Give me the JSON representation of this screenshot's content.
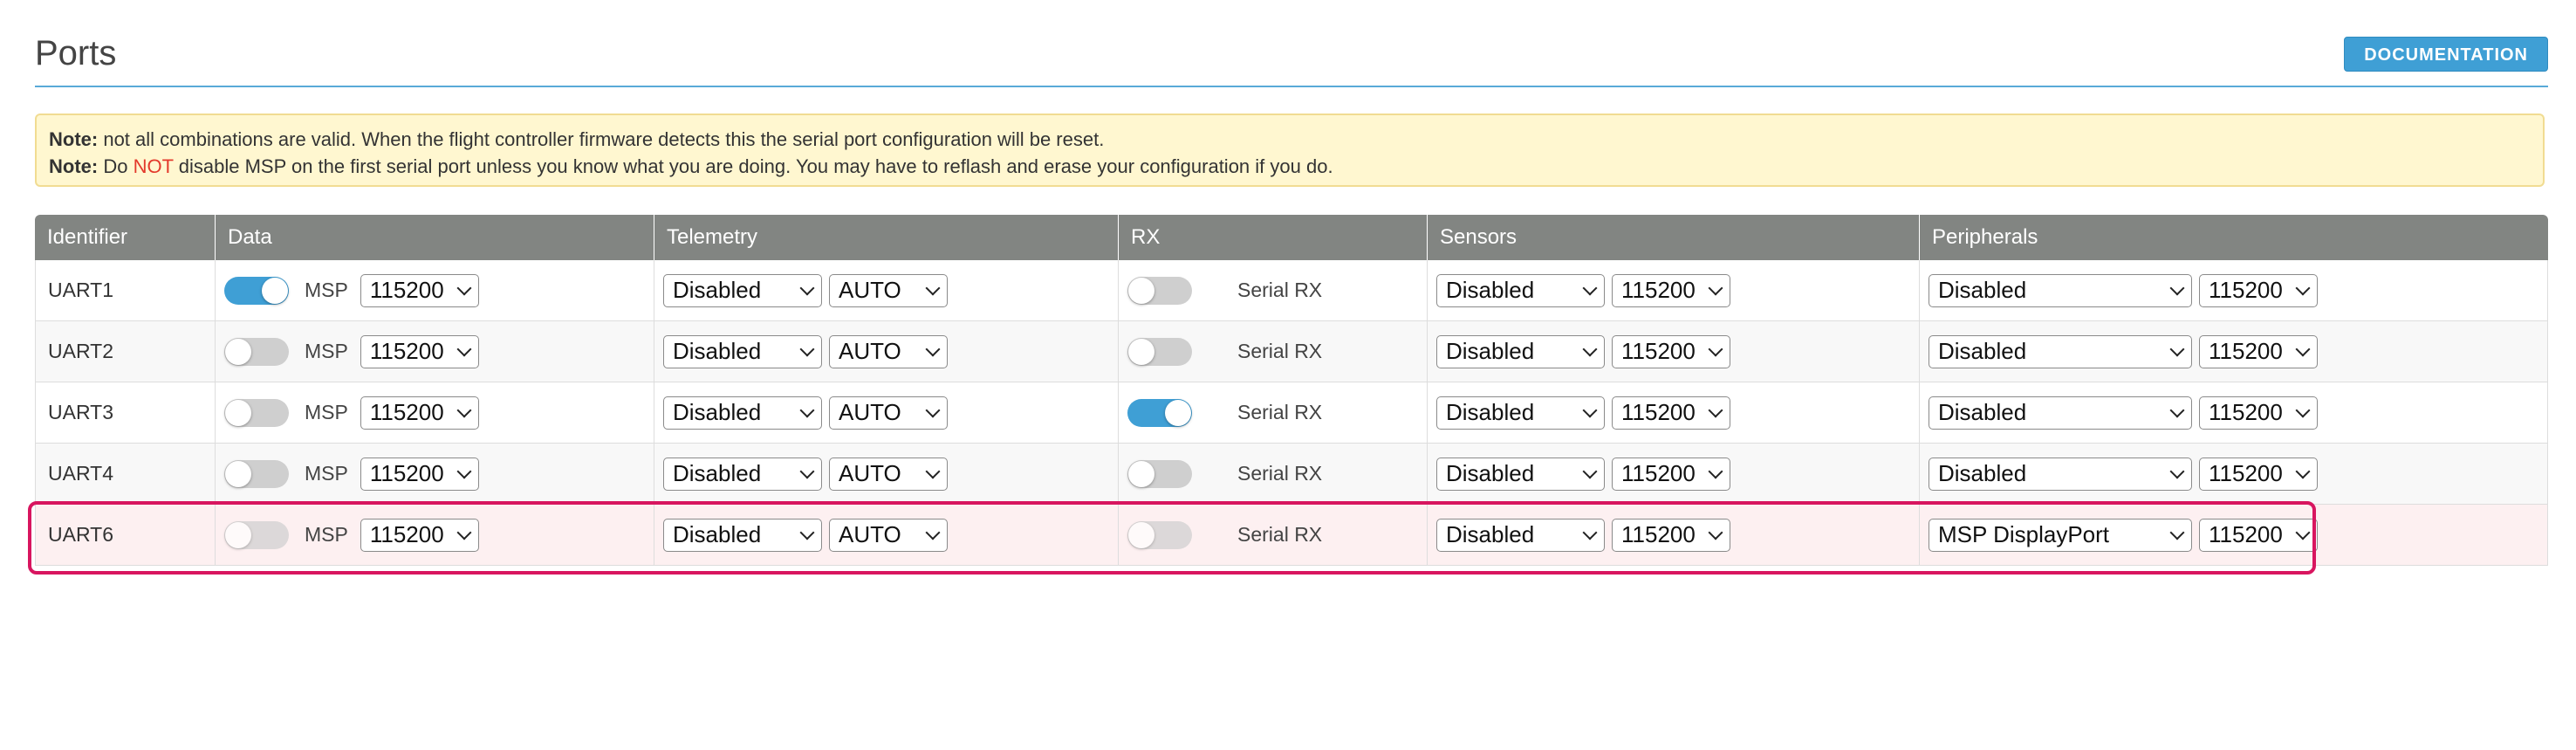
{
  "page": {
    "title": "Ports",
    "doc_button": "DOCUMENTATION"
  },
  "notes": {
    "line1_label": "Note:",
    "line1_text": " not all combinations are valid. When the flight controller firmware detects this the serial port configuration will be reset.",
    "line2_label": "Note:",
    "line2_pre": " Do ",
    "line2_not": "NOT",
    "line2_post": " disable MSP on the first serial port unless you know what you are doing. You may have to reflash and erase your configuration if you do."
  },
  "table": {
    "headers": [
      "Identifier",
      "Data",
      "Telemetry",
      "RX",
      "Sensors",
      "Peripherals"
    ],
    "msp_label": "MSP",
    "rx_label": "Serial RX",
    "rows": [
      {
        "id": "UART1",
        "msp_on": true,
        "data_baud": "115200",
        "telemetry": "Disabled",
        "telemetry_baud": "AUTO",
        "rx_on": false,
        "sensors": "Disabled",
        "sensors_baud": "115200",
        "peripherals": "Disabled",
        "peripherals_baud": "115200"
      },
      {
        "id": "UART2",
        "msp_on": false,
        "data_baud": "115200",
        "telemetry": "Disabled",
        "telemetry_baud": "AUTO",
        "rx_on": false,
        "sensors": "Disabled",
        "sensors_baud": "115200",
        "peripherals": "Disabled",
        "peripherals_baud": "115200"
      },
      {
        "id": "UART3",
        "msp_on": false,
        "data_baud": "115200",
        "telemetry": "Disabled",
        "telemetry_baud": "AUTO",
        "rx_on": true,
        "sensors": "Disabled",
        "sensors_baud": "115200",
        "peripherals": "Disabled",
        "peripherals_baud": "115200"
      },
      {
        "id": "UART4",
        "msp_on": false,
        "data_baud": "115200",
        "telemetry": "Disabled",
        "telemetry_baud": "AUTO",
        "rx_on": false,
        "sensors": "Disabled",
        "sensors_baud": "115200",
        "peripherals": "Disabled",
        "peripherals_baud": "115200"
      },
      {
        "id": "UART6",
        "msp_on": false,
        "data_baud": "115200",
        "telemetry": "Disabled",
        "telemetry_baud": "AUTO",
        "rx_on": false,
        "sensors": "Disabled",
        "sensors_baud": "115200",
        "peripherals": "MSP DisplayPort",
        "peripherals_baud": "115200",
        "highlighted": true
      }
    ]
  },
  "colors": {
    "accent": "#3f9fd5",
    "header_bg": "#828582",
    "note_bg": "#fff7d0",
    "highlight_border": "#d8155f",
    "warning_red": "#e33a2c"
  }
}
